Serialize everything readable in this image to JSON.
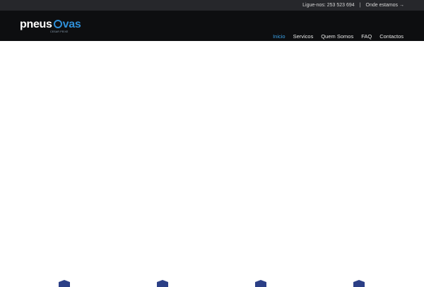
{
  "topbar": {
    "phone_text": "Ligue-nos: 253 523 694",
    "separator": "|",
    "location_link": "Onde estamos →"
  },
  "logo": {
    "brand_left": "pneus",
    "brand_right": "vas",
    "tagline": "CESAR PEIXE"
  },
  "nav": {
    "items": [
      {
        "label": "Inicio",
        "active": true
      },
      {
        "label": "Servicos"
      },
      {
        "label": "Quem Somos"
      },
      {
        "label": "FAQ"
      },
      {
        "label": "Contactos"
      }
    ]
  },
  "colors": {
    "accent": "#3aa0e6",
    "topbar": "#26272b",
    "header": "#0d0e10",
    "feature_icons": "#2b3f86"
  },
  "feature_icons": [
    "feature-icon",
    "feature-icon",
    "feature-icon",
    "feature-icon"
  ]
}
